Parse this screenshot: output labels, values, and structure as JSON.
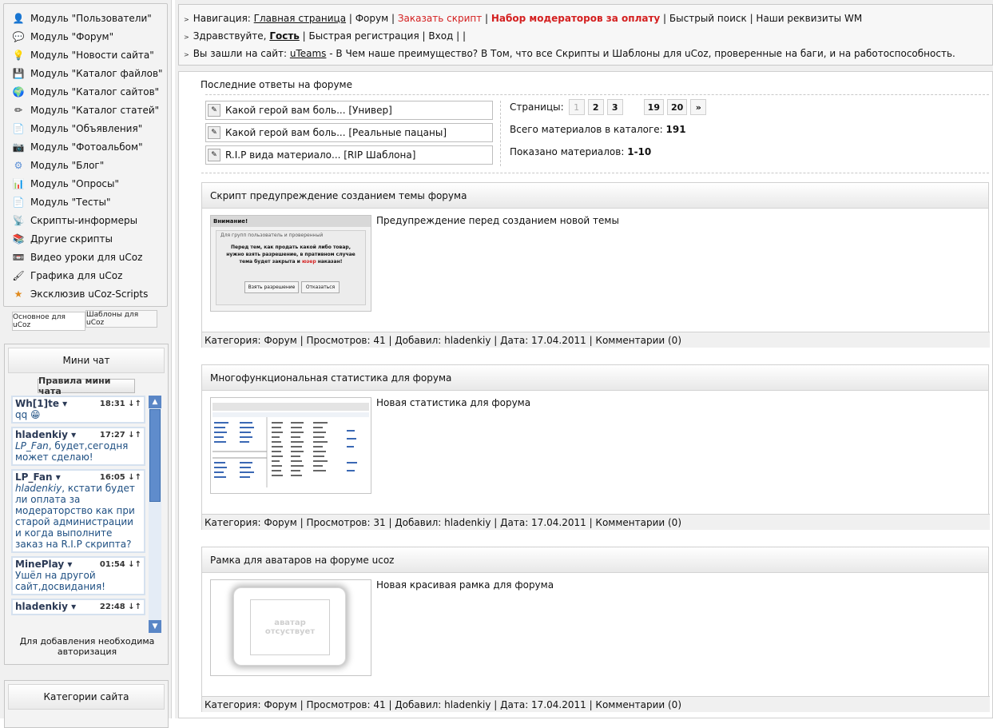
{
  "modules": [
    {
      "label": "Модуль \"Пользователи\"",
      "icon": "user-icon"
    },
    {
      "label": "Модуль \"Форум\"",
      "icon": "forum-bubble-icon"
    },
    {
      "label": "Модуль \"Новости сайта\"",
      "icon": "lightbulb-icon"
    },
    {
      "label": "Модуль \"Каталог файлов\"",
      "icon": "floppy-disk-icon"
    },
    {
      "label": "Модуль \"Каталог сайтов\"",
      "icon": "globe-icon"
    },
    {
      "label": "Модуль \"Каталог статей\"",
      "icon": "pencil-icon"
    },
    {
      "label": "Модуль \"Объявления\"",
      "icon": "document-icon"
    },
    {
      "label": "Модуль \"Фотоальбом\"",
      "icon": "camera-icon"
    },
    {
      "label": "Модуль \"Блог\"",
      "icon": "gear-icon"
    },
    {
      "label": "Модуль \"Опросы\"",
      "icon": "bar-chart-icon"
    },
    {
      "label": "Модуль \"Тесты\"",
      "icon": "document-icon"
    },
    {
      "label": "Скрипты-информеры",
      "icon": "broadcast-icon"
    },
    {
      "label": "Другие скрипты",
      "icon": "scripts-icon"
    },
    {
      "label": "Видео уроки для uCoz",
      "icon": "video-icon"
    },
    {
      "label": "Графика для uCoz",
      "icon": "brush-icon"
    },
    {
      "label": "Эксклюзив uCoz-Scripts",
      "icon": "star-icon"
    }
  ],
  "module_tabs": [
    "Основное для uCoz",
    "Шаблоны для uCoz"
  ],
  "chat": {
    "title": "Мини чат",
    "rules_button": "Правила мини чата",
    "messages": [
      {
        "nick": "Wh[1]te ▾",
        "time": "18:31 ↓↑",
        "pre": "",
        "text": "qq 😁"
      },
      {
        "nick": "hladenkiy ▾",
        "time": "17:27 ↓↑",
        "pre": "LP_Fan",
        "text": ", будет,сегодня может сделаю!"
      },
      {
        "nick": "LP_Fan ▾",
        "time": "16:05 ↓↑",
        "pre": "hladenkiy",
        "text": ", кстати будет ли оплата за модераторство как при старой администрации и когда выполните заказ на R.I.P скрипта?"
      },
      {
        "nick": "MinePlay ▾",
        "time": "01:54 ↓↑",
        "pre": "",
        "text": "Ушёл на другой сайт,досвидания!"
      },
      {
        "nick": "hladenkiy ▾",
        "time": "22:48 ↓↑",
        "pre": "",
        "text": ""
      }
    ],
    "note": "Для добавления необходима авторизация"
  },
  "categories_title": "Категории сайта",
  "nav": {
    "line1_prefix": "Навигация:",
    "home": "Главная страница",
    "forum": "Форум",
    "order": "Заказать скрипт",
    "moderators": "Набор модераторов за оплату",
    "quick_search": "Быстрый поиск",
    "requisites": "Наши реквизиты WM",
    "line2_prefix": "Здравствуйте,",
    "guest": "Гость",
    "quick_reg": "Быстрая регистрация",
    "login": "Вход",
    "line3_prefix": "Вы зашли на сайт:",
    "site": "uTeams",
    "line3_rest": "- В Чем наше преимущество? В Том, что все Скрипты и Шаблоны для uCoz, проверенные на баги, и на работоспособность."
  },
  "forum": {
    "title": "Последние ответы на форуме",
    "items": [
      "Какой герой вам боль... [Универ]",
      "Какой герой вам боль... [Реальные пацаны]",
      "R.I.P вида материало... [RIP Шаблона]"
    ]
  },
  "pager": {
    "label": "Страницы:",
    "pages": [
      "1",
      "2",
      "3",
      "19",
      "20",
      "»"
    ],
    "total_label": "Всего материалов в каталоге:",
    "total": "191",
    "shown_label": "Показано материалов:",
    "shown": "1-10"
  },
  "entries": [
    {
      "title": "Скрипт предупреждение созданием темы форума",
      "desc": "Предупреждение перед созданием новой темы",
      "footer": "Категория: Форум | Просмотров: 41 | Добавил: hladenkiy | Дата: 17.04.2011 | Комментарии (0)",
      "thumb": {
        "head": "Внимание!",
        "sub": "Для групп пользователь и проверенный",
        "t1": "Перед тем, как продать какой либо товар,",
        "t2": "нужно взять разрешение, в пративном случае",
        "t3": "тема будет закрыта и",
        "t3red": "юзер",
        "t3end": "наказан!",
        "b1": "Взять разрешение",
        "b2": "Отказаться"
      }
    },
    {
      "title": "Многофункциональная статистика для форума",
      "desc": "Новая статистика для форума",
      "footer": "Категория: Форум | Просмотров: 31 | Добавил: hladenkiy | Дата: 17.04.2011 | Комментарии (0)"
    },
    {
      "title": "Рамка для аватаров на форуме ucoz",
      "desc": "Новая красивая рамка для форума",
      "footer": "Категория: Форум | Просмотров: 41 | Добавил: hladenkiy | Дата: 17.04.2011 | Комментарии (0)",
      "avatar_text1": "аватар",
      "avatar_text2": "отсуствует"
    }
  ]
}
